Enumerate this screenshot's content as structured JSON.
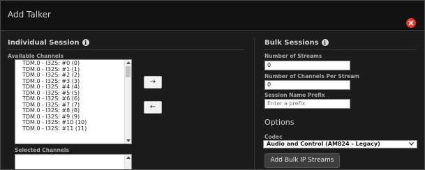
{
  "dialog": {
    "title": "Add Talker",
    "close_icon": "close-icon"
  },
  "individual": {
    "title": "Individual Session",
    "info_icon": "info-icon",
    "available_label": "Available Channels",
    "channels": [
      "TDM.0 - I32S: #0 (0)",
      "TDM.0 - I32S: #1 (1)",
      "TDM.0 - I32S: #2 (2)",
      "TDM.0 - I32S: #3 (3)",
      "TDM.0 - I32S: #4 (4)",
      "TDM.0 - I32S: #5 (5)",
      "TDM.0 - I32S: #6 (6)",
      "TDM.0 - I32S: #7 (7)",
      "TDM.0 - I32S: #8 (8)",
      "TDM.0 - I32S: #9 (9)",
      "TDM.0 - I32S: #10 (10)",
      "TDM.0 - I32S: #11 (11)"
    ],
    "add_arrow": "→",
    "remove_arrow": "←",
    "selected_label": "Selected Channels"
  },
  "bulk": {
    "title": "Bulk Sessions",
    "info_icon": "info-icon",
    "streams_label": "Number of Streams",
    "streams_value": "0",
    "channels_per_stream_label": "Number of Channels Per Stream",
    "channels_per_stream_value": "0",
    "prefix_label": "Session Name Prefix",
    "prefix_placeholder": "Enter a prefix",
    "options_title": "Options",
    "codec_label": "Codec",
    "codec_value": "Audio and Control (AM824 - Legacy)",
    "add_button": "Add Bulk IP Streams"
  },
  "colors": {
    "background": "#1c1c1c",
    "titlebar": "#121212",
    "close": "#e0392b",
    "button": "#3e3e3e"
  }
}
